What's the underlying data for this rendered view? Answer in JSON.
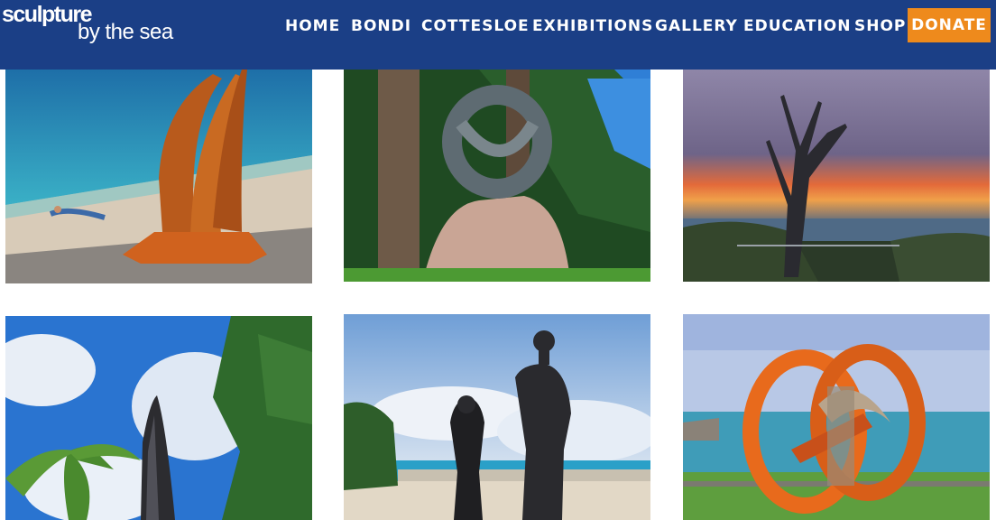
{
  "logo": {
    "line1": "sculpture",
    "line2": "by the sea"
  },
  "nav": {
    "items": [
      "HOME",
      "BONDI",
      "COTTESLOE",
      "EXHIBITIONS",
      "GALLERY",
      "EDUCATION",
      "SHOP"
    ],
    "donate": "DONATE"
  },
  "colors": {
    "header": "#1b3f86",
    "donate": "#ee8a1c",
    "nav_text": "#ffffff"
  },
  "gallery": {
    "images": [
      "rust-flame-sculpture-on-beach",
      "stone-knot-sculpture-on-rock",
      "dead-tree-at-sunset",
      "stone-obelisk-with-palms",
      "two-figure-statues",
      "orange-ring-sculpture-by-sea"
    ]
  }
}
